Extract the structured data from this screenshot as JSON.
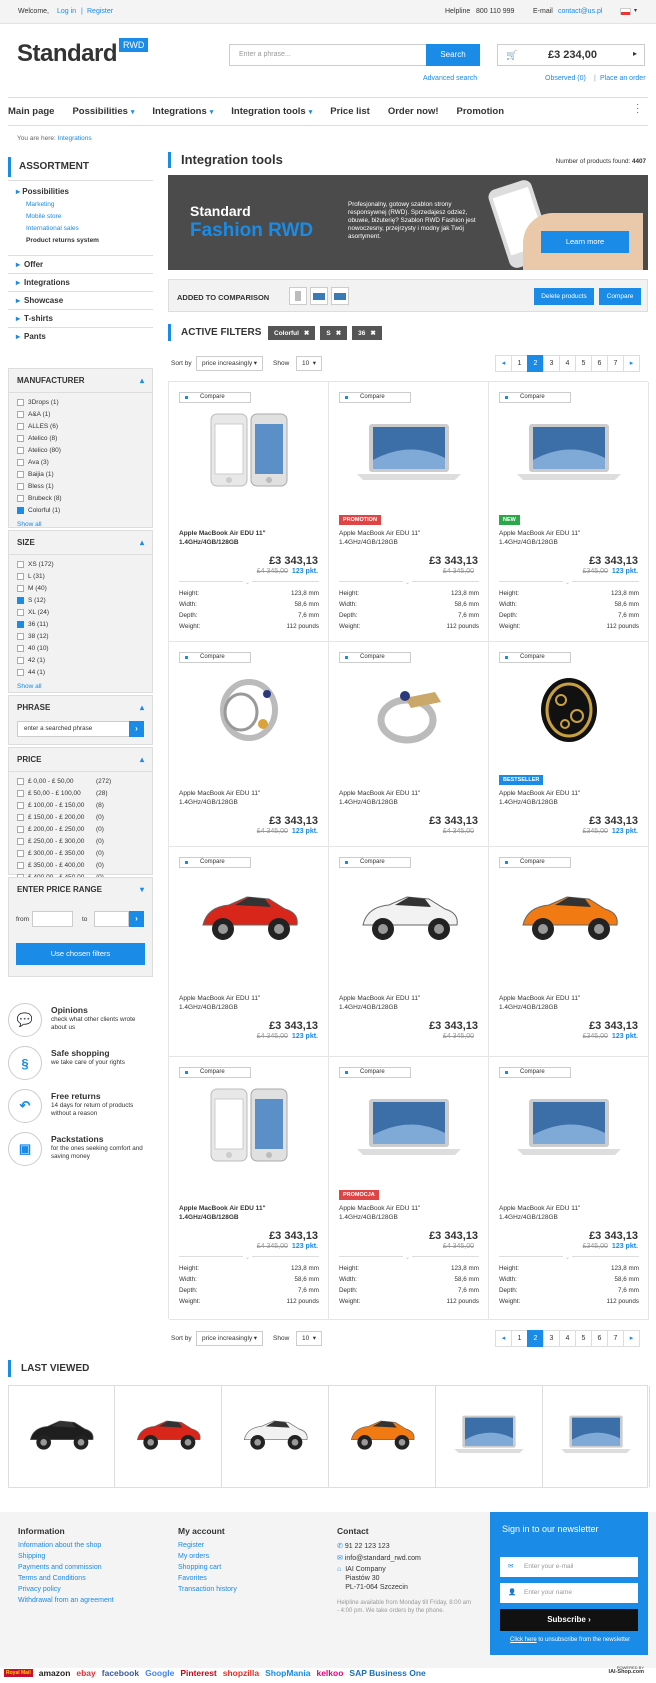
{
  "topbar": {
    "welcome": "Welcome,",
    "login": "Log in",
    "sep": "|",
    "register": "Register",
    "helpline_label": "Helpline",
    "helpline_number": "800 110 999",
    "email_label": "E-mail",
    "email": "contact@us.pl"
  },
  "header": {
    "logo": "Standard",
    "logo_badge": "RWD",
    "search_placeholder": "Enter a phrase...",
    "search_button": "Search",
    "advanced": "Advanced search",
    "cart_total": "£3 234,00",
    "observed": "Observed (0)",
    "place_order": "Place an order"
  },
  "nav": {
    "items": [
      "Main page",
      "Possibilities",
      "Integrations",
      "Integration tools",
      "Price list",
      "Order now!",
      "Promotion"
    ],
    "dropdown": [
      false,
      true,
      true,
      true,
      false,
      false,
      false
    ]
  },
  "breadcrumb": {
    "label": "You are here:",
    "current": "Integrations"
  },
  "sidebar": {
    "assortment_title": "ASSORTMENT",
    "possibilities": "Possibilities",
    "sub": [
      "Marketing",
      "Mobile store",
      "International sales",
      "Product returns system"
    ],
    "cats": [
      "Offer",
      "Integrations",
      "Showcase",
      "T-shirts",
      "Pants"
    ],
    "manufacturer_title": "MANUFACTURER",
    "manufacturers": [
      {
        "n": "3Drops (1)",
        "c": false
      },
      {
        "n": "A&A (1)",
        "c": false
      },
      {
        "n": "ALLES (6)",
        "c": false
      },
      {
        "n": "Atelico (8)",
        "c": false
      },
      {
        "n": "Atelico (80)",
        "c": false
      },
      {
        "n": "Ava (3)",
        "c": false
      },
      {
        "n": "Baijia (1)",
        "c": false
      },
      {
        "n": "Bless (1)",
        "c": false
      },
      {
        "n": "Brubeck (8)",
        "c": false
      },
      {
        "n": "Colorful (1)",
        "c": true
      }
    ],
    "show_all": "Show all",
    "size_title": "SIZE",
    "sizes": [
      {
        "n": "XS (172)",
        "c": false
      },
      {
        "n": "L (31)",
        "c": false
      },
      {
        "n": "M (40)",
        "c": false
      },
      {
        "n": "S (12)",
        "c": true
      },
      {
        "n": "XL (24)",
        "c": false
      },
      {
        "n": "36 (11)",
        "c": true
      },
      {
        "n": "38 (12)",
        "c": false
      },
      {
        "n": "40 (10)",
        "c": false
      },
      {
        "n": "42 (1)",
        "c": false
      },
      {
        "n": "44 (1)",
        "c": false
      }
    ],
    "phrase_title": "PHRASE",
    "phrase_placeholder": "enter a searched phrase",
    "price_title": "PRICE",
    "prices": [
      {
        "n": "£ 0,00 - £ 50,00",
        "q": "(272)"
      },
      {
        "n": "£ 50,00 - £ 100,00",
        "q": "(28)"
      },
      {
        "n": "£ 100,00 - £ 150,00",
        "q": "(8)"
      },
      {
        "n": "£ 150,00 - £ 200,00",
        "q": "(0)"
      },
      {
        "n": "£ 200,00 - £ 250,00",
        "q": "(0)"
      },
      {
        "n": "£ 250,00 - £ 300,00",
        "q": "(0)"
      },
      {
        "n": "£ 300,00 - £ 350,00",
        "q": "(0)"
      },
      {
        "n": "£ 350,00 - £ 400,00",
        "q": "(0)"
      },
      {
        "n": "£ 400,00 - £ 450,00",
        "q": "(0)"
      }
    ],
    "range_title": "ENTER PRICE RANGE",
    "from": "from",
    "to": "to",
    "use_filters": "Use chosen filters"
  },
  "features": [
    {
      "icon": "chat-icon",
      "glyph": "💬",
      "title": "Opinions",
      "text": "check what other clients wrote about us"
    },
    {
      "icon": "paragraph-icon",
      "glyph": "§",
      "title": "Safe shopping",
      "text": "we take care of your rights"
    },
    {
      "icon": "return-arrow-icon",
      "glyph": "↶",
      "title": "Free returns",
      "text": "14 days for return of products without a reason"
    },
    {
      "icon": "package-icon",
      "glyph": "▣",
      "title": "Packstations",
      "text": "for the ones seeking comfort and saving money"
    }
  ],
  "main": {
    "title": "Integration tools",
    "found_label": "Number of products found:",
    "found": "4407",
    "banner": {
      "l1": "Standard",
      "l2": "Fashion RWD",
      "text": "Profesjonalny, gotowy szablon strony responsywnej (RWD). Sprzedajesz odzież, obuwie, biżuterię? Szablon RWD Fashion jest nowoczesny, przejrzysty i modny jak Twój asortyment.",
      "btn": "Learn more"
    },
    "comparison": {
      "label": "ADDED TO COMPARISON",
      "delete": "Delete products",
      "compare": "Compare"
    },
    "active_filters": {
      "label": "ACTIVE FILTERS",
      "tags": [
        "Colorful",
        "S",
        "36"
      ]
    },
    "sort_label": "Sort by",
    "sort_value": "price increasingly",
    "show_label": "Show",
    "show_value": "10",
    "pages": [
      "1",
      "2",
      "3",
      "4",
      "5",
      "6",
      "7"
    ],
    "active_page": "2"
  },
  "product_common": {
    "compare": "Compare",
    "name": "Apple MacBook Air EDU 11\" 1.4GHz/4GB/128GB",
    "price": "£3 343,13",
    "old": "£4 345,00",
    "old2": "£345,00",
    "pts": "123 pkt.",
    "spec_labels": [
      "Height:",
      "Width:",
      "Depth:",
      "Weight:"
    ],
    "spec_values": [
      "123,8 mm",
      "58,6 mm",
      "7,6 mm",
      "112 pounds"
    ]
  },
  "products": [
    {
      "img": "phone",
      "badge": "",
      "bold": true,
      "old": "£4 345,00",
      "pts": true,
      "specs": true
    },
    {
      "img": "laptop",
      "badge": "PROMOTION",
      "badgeColor": "#e04545",
      "bold": false,
      "old": "£4 345,00",
      "pts": false,
      "specs": true
    },
    {
      "img": "laptop",
      "badge": "NEW",
      "badgeColor": "#2aa84a",
      "bold": false,
      "old": "£345,00",
      "pts": true,
      "specs": true
    },
    {
      "img": "ring1",
      "badge": "",
      "bold": false,
      "old": "£4 345,00",
      "pts": true,
      "specs": false
    },
    {
      "img": "ring2",
      "badge": "",
      "bold": false,
      "old": "£4 345,00",
      "pts": false,
      "specs": false
    },
    {
      "img": "ring3",
      "badge": "BESTSELLER",
      "badgeColor": "#1a8be6",
      "bold": false,
      "old": "£345,00",
      "pts": true,
      "specs": false
    },
    {
      "img": "car-red",
      "badge": "",
      "bold": false,
      "old": "£4 345,00",
      "pts": true,
      "specs": false
    },
    {
      "img": "car-white",
      "badge": "",
      "bold": false,
      "old": "£4 345,00",
      "pts": false,
      "specs": false
    },
    {
      "img": "car-orange",
      "badge": "",
      "bold": false,
      "old": "£345,00",
      "pts": true,
      "specs": false
    },
    {
      "img": "phone",
      "badge": "",
      "bold": true,
      "old": "£4 345,00",
      "pts": true,
      "specs": true
    },
    {
      "img": "laptop",
      "badge": "PROMOCJA",
      "badgeColor": "#e04545",
      "bold": false,
      "old": "£4 345,00",
      "pts": false,
      "specs": true
    },
    {
      "img": "laptop",
      "badge": "",
      "bold": false,
      "old": "£345,00",
      "pts": true,
      "specs": true
    }
  ],
  "last_viewed": {
    "title": "LAST VIEWED",
    "items": [
      "car-black",
      "car-red",
      "car-white",
      "car-orange",
      "laptop",
      "laptop"
    ]
  },
  "footer": {
    "info_title": "Information",
    "info": [
      "Information about the shop",
      "Shipping",
      "Payments and commission",
      "Terms and Conditions",
      "Privacy policy",
      "Withdrawal from an agreement"
    ],
    "acc_title": "My account",
    "acc": [
      "Register",
      "My orders",
      "Shopping cart",
      "Favorites",
      "Transaction history"
    ],
    "contact_title": "Contact",
    "phone": "91 22 123 123",
    "mail": "info@standard_rwd.com",
    "addr": [
      "IAI Company",
      "Piastów 30",
      "PL-71-064 Szczecin"
    ],
    "hours": "Helpline available from Monday till Friday, 8:00 am - 4:00 pm. We take orders by the phone.",
    "news_title": "Sign in to our newsletter",
    "news_email": "Enter your e-mail",
    "news_name": "Enter your name",
    "subscribe": "Subscribe",
    "unsub_link": "Click here",
    "unsub_text": "to unsubscribe from the newsletter"
  },
  "brands": [
    "Royal Mail",
    "amazon",
    "ebay",
    "facebook",
    "Google",
    "Pinterest",
    "shopzilla",
    "ShopMania",
    "kelkoo",
    "SAP Business One"
  ],
  "powered": "POWERED BY",
  "iai": "IAI-Shop.com",
  "colors": {
    "accent": "#1a8be6",
    "promo": "#e04545",
    "new": "#2aa84a"
  }
}
